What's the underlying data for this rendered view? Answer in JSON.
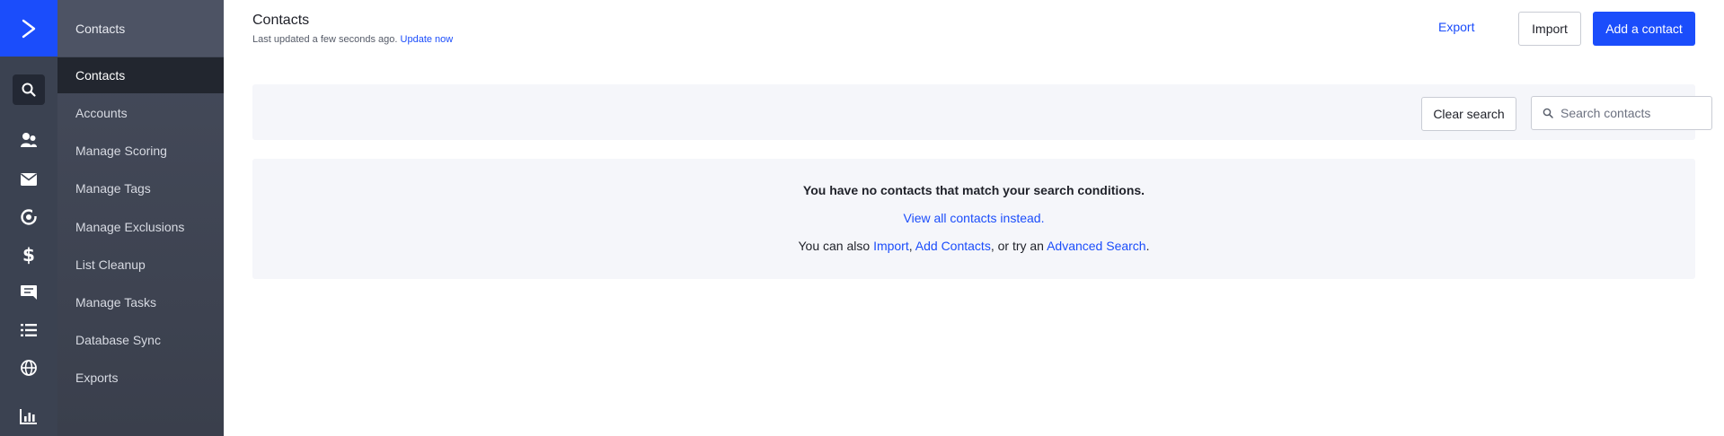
{
  "rail": {
    "items": [
      {
        "icon": "search-icon"
      },
      {
        "icon": "contacts-icon"
      },
      {
        "icon": "mail-icon"
      },
      {
        "icon": "automation-icon"
      },
      {
        "icon": "deals-icon"
      },
      {
        "icon": "conversations-icon"
      },
      {
        "icon": "lists-icon"
      },
      {
        "icon": "site-icon"
      },
      {
        "icon": "reports-icon"
      }
    ]
  },
  "subnav": {
    "heading": "Contacts",
    "items": [
      {
        "label": "Contacts",
        "active": true
      },
      {
        "label": "Accounts"
      },
      {
        "label": "Manage Scoring"
      },
      {
        "label": "Manage Tags"
      },
      {
        "label": "Manage Exclusions"
      },
      {
        "label": "List Cleanup"
      },
      {
        "label": "Manage Tasks"
      },
      {
        "label": "Database Sync"
      },
      {
        "label": "Exports"
      }
    ]
  },
  "header": {
    "title": "Contacts",
    "updated_text": "Last updated a few seconds ago.",
    "update_link": "Update now",
    "export_label": "Export",
    "import_label": "Import",
    "add_label": "Add a contact"
  },
  "search": {
    "clear_label": "Clear search",
    "placeholder": "Search contacts",
    "value": ""
  },
  "empty": {
    "title": "You have no contacts that match your search conditions.",
    "view_all_link": "View all contacts instead.",
    "also_prefix": "You can also ",
    "import_link": "Import",
    "sep1": ", ",
    "add_link": "Add Contacts",
    "sep2": ", or try an ",
    "advanced_link": "Advanced Search",
    "suffix": "."
  },
  "colors": {
    "accent": "#1b4dfb",
    "rail_bg": "#3b4251",
    "panel_bg": "#f5f6fa"
  }
}
